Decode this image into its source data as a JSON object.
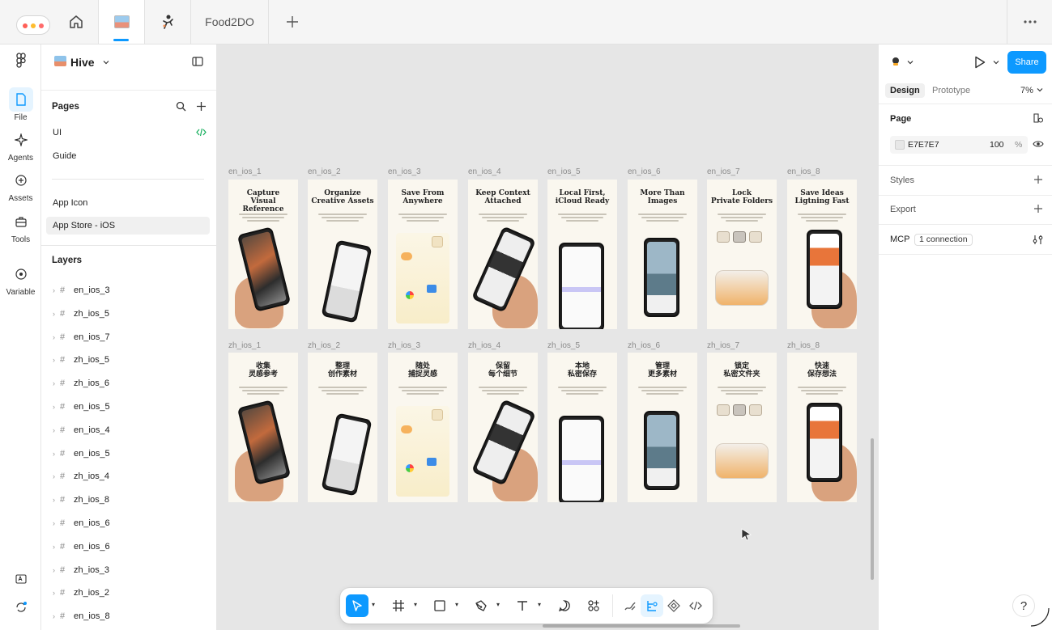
{
  "topbar": {
    "tabs": [
      {
        "kind": "home",
        "icon": "home-icon"
      },
      {
        "kind": "file",
        "icon": "file-thumbnail-icon",
        "active": true
      },
      {
        "kind": "file",
        "icon": "figure-thumbnail-icon"
      },
      {
        "kind": "text",
        "label": "Food2DO"
      }
    ],
    "add_icon": "plus-icon",
    "more_icon": "more-horizontal-icon"
  },
  "rail": {
    "items": [
      {
        "label": "File",
        "icon": "file-icon",
        "active": true
      },
      {
        "label": "Agents",
        "icon": "sparkle-icon"
      },
      {
        "label": "Assets",
        "icon": "assets-icon"
      },
      {
        "label": "Tools",
        "icon": "toolbox-icon"
      },
      {
        "label": "Variable",
        "icon": "variable-icon"
      }
    ]
  },
  "left_panel": {
    "file_name": "Hive",
    "pages_title": "Pages",
    "pages": [
      {
        "label": "UI",
        "has_code": true
      },
      {
        "label": "Guide"
      },
      {
        "label": "App Icon"
      },
      {
        "label": "App Store - iOS",
        "selected": true
      }
    ],
    "layers_title": "Layers",
    "layers": [
      "en_ios_3",
      "zh_ios_5",
      "en_ios_7",
      "zh_ios_5",
      "zh_ios_6",
      "en_ios_5",
      "en_ios_4",
      "en_ios_5",
      "zh_ios_4",
      "zh_ios_8",
      "en_ios_6",
      "en_ios_6",
      "zh_ios_3",
      "zh_ios_2",
      "en_ios_8"
    ]
  },
  "canvas": {
    "background": "#E6E6E6",
    "rows": [
      {
        "frames": [
          {
            "label": "en_ios_1",
            "title": [
              "Capture",
              "Visual Reference"
            ]
          },
          {
            "label": "en_ios_2",
            "title": [
              "Organize",
              "Creative Assets"
            ]
          },
          {
            "label": "en_ios_3",
            "title": [
              "Save From",
              "Anywhere"
            ]
          },
          {
            "label": "en_ios_4",
            "title": [
              "Keep Context",
              "Attached"
            ]
          },
          {
            "label": "en_ios_5",
            "title": [
              "Local First,",
              "iCloud Ready"
            ]
          },
          {
            "label": "en_ios_6",
            "title": [
              "More Than",
              "Images"
            ]
          },
          {
            "label": "en_ios_7",
            "title": [
              "Lock",
              "Private Folders"
            ]
          },
          {
            "label": "en_ios_8",
            "title": [
              "Save Ideas",
              "Ligtning Fast"
            ]
          }
        ]
      },
      {
        "frames": [
          {
            "label": "zh_ios_1",
            "title": [
              "收集",
              "灵感参考"
            ]
          },
          {
            "label": "zh_ios_2",
            "title": [
              "整理",
              "创作素材"
            ]
          },
          {
            "label": "zh_ios_3",
            "title": [
              "随处",
              "捕捉灵感"
            ]
          },
          {
            "label": "zh_ios_4",
            "title": [
              "保留",
              "每个细节"
            ]
          },
          {
            "label": "zh_ios_5",
            "title": [
              "本地",
              "私密保存"
            ]
          },
          {
            "label": "zh_ios_6",
            "title": [
              "管理",
              "更多素材"
            ]
          },
          {
            "label": "zh_ios_7",
            "title": [
              "锁定",
              "私密文件夹"
            ]
          },
          {
            "label": "zh_ios_8",
            "title": [
              "快速",
              "保存想法"
            ]
          }
        ]
      }
    ]
  },
  "toolbar": {
    "tools": [
      "move-icon",
      "frame-icon",
      "rectangle-icon",
      "pen-icon",
      "text-icon",
      "comment-icon",
      "actions-icon"
    ],
    "modes": [
      "draw-icon",
      "design-mode-icon",
      "component-icon",
      "dev-mode-icon"
    ]
  },
  "right_panel": {
    "share_label": "Share",
    "tabs": {
      "design": "Design",
      "prototype": "Prototype"
    },
    "zoom": "7%",
    "page_title": "Page",
    "page_color": "E7E7E7",
    "page_opacity": "100",
    "percent": "%",
    "styles_title": "Styles",
    "export_title": "Export",
    "mcp_title": "MCP",
    "mcp_status": "1 connection"
  },
  "help_label": "?",
  "colors": {
    "accent": "#0D99FF",
    "canvas": "#E6E6E6",
    "frame": "#FAF7EF"
  }
}
